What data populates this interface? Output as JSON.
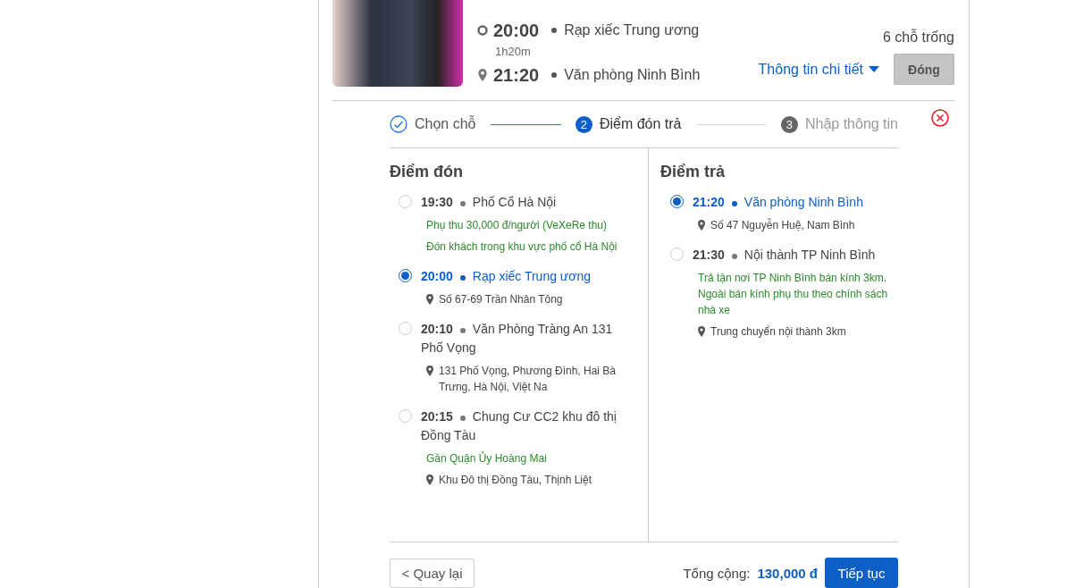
{
  "trip": {
    "depart_time": "20:00",
    "depart_place": "Rạp xiếc Trung ương",
    "duration": "1h20m",
    "arrive_time": "21:20",
    "arrive_place": "Văn phòng Ninh Bình",
    "seats": "6 chỗ trống",
    "details_link": "Thông tin chi tiết",
    "close_button": "Đóng"
  },
  "steps": [
    {
      "label": "Chọn chỗ",
      "completed": true,
      "selected": false
    },
    {
      "number": "2",
      "label": "Điểm đón trả",
      "completed": false,
      "selected": true
    },
    {
      "number": "3",
      "label": "Nhập thông tin",
      "completed": false,
      "selected": false
    }
  ],
  "pickup": {
    "title": "Điểm đón",
    "points": [
      {
        "time": "19:30",
        "place": "Phố Cổ Hà Nội",
        "selected": false,
        "lines": [
          {
            "kind": "note",
            "text": "Phụ thu 30,000 đ/người (VeXeRe thu)"
          },
          {
            "kind": "note",
            "text": "Đón khách trong khu vực phố cổ Hà Nội"
          }
        ]
      },
      {
        "time": "20:00",
        "place": "Rạp xiếc Trung ương",
        "selected": true,
        "lines": [
          {
            "kind": "address",
            "text": "Số 67-69 Trần Nhân Tông"
          }
        ]
      },
      {
        "time": "20:10",
        "place": "Văn Phòng Tràng An 131 Phố Vọng",
        "selected": false,
        "lines": [
          {
            "kind": "address",
            "text": "131 Phố Vọng, Phương Đình, Hai Bà Trưng, Hà Nội, Việt Na"
          }
        ]
      },
      {
        "time": "20:15",
        "place": "Chung Cư CC2 khu đô thị Đồng Tàu",
        "selected": false,
        "lines": [
          {
            "kind": "note",
            "text": "Gần Quận Ủy Hoàng Mai"
          },
          {
            "kind": "address",
            "text": "Khu Đô thị Đồng Tàu, Thịnh Liệt"
          }
        ]
      }
    ]
  },
  "dropoff": {
    "title": "Điểm trả",
    "points": [
      {
        "time": "21:20",
        "place": "Văn phòng Ninh Bình",
        "selected": true,
        "lines": [
          {
            "kind": "address",
            "text": "Số 47 Nguyễn Huệ, Nam Bình"
          }
        ]
      },
      {
        "time": "21:30",
        "place": "Nội thành TP Ninh Bình",
        "selected": false,
        "lines": [
          {
            "kind": "note",
            "text": "Trả tận nơi TP Ninh Bình bán kính 3km. Ngoài bán kính phụ thu theo chính sách nhà xe"
          },
          {
            "kind": "address",
            "text": "Trung chuyển nội thành 3km"
          }
        ]
      }
    ]
  },
  "footer": {
    "back_button": "< Quay lại",
    "total_label": "Tổng cộng:",
    "total_value": "130,000 đ",
    "next_button": "Tiếp tục"
  }
}
